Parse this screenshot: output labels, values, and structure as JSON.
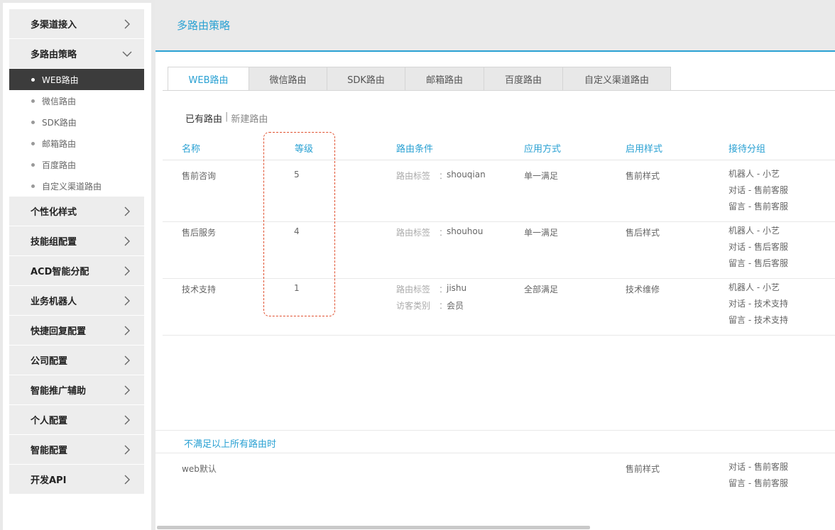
{
  "sidebar": {
    "groups_top": [
      {
        "label": "多渠道接入"
      },
      {
        "label": "多路由策略"
      }
    ],
    "sub_items": [
      {
        "label": "WEB路由"
      },
      {
        "label": "微信路由"
      },
      {
        "label": "SDK路由"
      },
      {
        "label": "邮箱路由"
      },
      {
        "label": "百度路由"
      },
      {
        "label": "自定义渠道路由"
      }
    ],
    "groups_bottom": [
      {
        "label": "个性化样式"
      },
      {
        "label": "技能组配置"
      },
      {
        "label": "ACD智能分配"
      },
      {
        "label": "业务机器人"
      },
      {
        "label": "快捷回复配置"
      },
      {
        "label": "公司配置"
      },
      {
        "label": "智能推广辅助"
      },
      {
        "label": "个人配置"
      },
      {
        "label": "智能配置"
      },
      {
        "label": "开发API"
      }
    ]
  },
  "header": {
    "title": "多路由策略"
  },
  "tabs": [
    {
      "label": "WEB路由"
    },
    {
      "label": "微信路由"
    },
    {
      "label": "SDK路由"
    },
    {
      "label": "邮箱路由"
    },
    {
      "label": "百度路由"
    },
    {
      "label": "自定义渠道路由"
    }
  ],
  "subnav": {
    "existing": "已有路由",
    "separator": "|",
    "create": "新建路由"
  },
  "table": {
    "headers": {
      "name": "名称",
      "level": "等级",
      "condition": "路由条件",
      "apply": "应用方式",
      "style": "启用样式",
      "group": "接待分组"
    },
    "rows": [
      {
        "name": "售前咨询",
        "level": "5",
        "conditions": [
          {
            "key": "路由标签",
            "sep": "：",
            "value": "shouqian"
          }
        ],
        "apply": "单一满足",
        "style": "售前样式",
        "groups": [
          "机器人 - 小艺",
          "对话 - 售前客服",
          "留言 - 售前客服"
        ]
      },
      {
        "name": "售后服务",
        "level": "4",
        "conditions": [
          {
            "key": "路由标签",
            "sep": "：",
            "value": "shouhou"
          }
        ],
        "apply": "单一满足",
        "style": "售后样式",
        "groups": [
          "机器人 - 小艺",
          "对话 - 售后客服",
          "留言 - 售后客服"
        ]
      },
      {
        "name": "技术支持",
        "level": "1",
        "conditions": [
          {
            "key": "路由标签",
            "sep": "：",
            "value": "jishu"
          },
          {
            "key": "访客类别",
            "sep": "：",
            "value": "会员"
          }
        ],
        "apply": "全部满足",
        "style": "技术维修",
        "groups": [
          "机器人 - 小艺",
          "对话 - 技术支持",
          "留言 - 技术支持"
        ]
      }
    ]
  },
  "fallback": {
    "title": "不满足以上所有路由时",
    "name": "web默认",
    "style": "售前样式",
    "groups": [
      "对话 - 售前客服",
      "留言 - 售前客服"
    ]
  },
  "colors": {
    "accent": "#2aa1d3",
    "active_sidebar": "#3c3c3c",
    "highlight": "#e0502f"
  },
  "icons": {
    "collapsed": "chevron-right-icon",
    "expanded": "chevron-down-icon"
  }
}
